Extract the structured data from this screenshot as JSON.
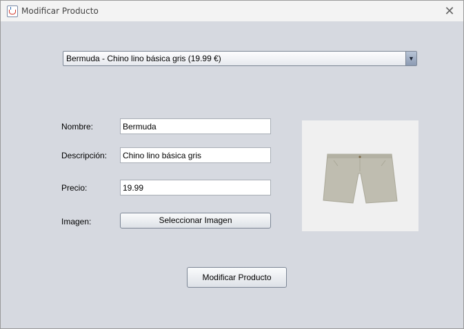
{
  "window": {
    "title": "Modificar Producto",
    "close_symbol": "✕",
    "app_icon": "java-icon"
  },
  "product_selector": {
    "selected": "Bermuda - Chino lino básica gris (19.99 €)",
    "arrow_icon": "combo-arrow-icon",
    "arrow_symbol": "▼"
  },
  "form": {
    "nombre_label": "Nombre:",
    "nombre_value": "Bermuda",
    "descripcion_label": "Descripción:",
    "descripcion_value": "Chino lino básica gris",
    "precio_label": "Precio:",
    "precio_value": "19.99",
    "imagen_label": "Imagen:",
    "select_image_button": "Seleccionar Imagen"
  },
  "preview": {
    "image_icon": "shorts-image",
    "shorts_color": "#bfbdb0"
  },
  "actions": {
    "submit_button": "Modificar Producto"
  }
}
